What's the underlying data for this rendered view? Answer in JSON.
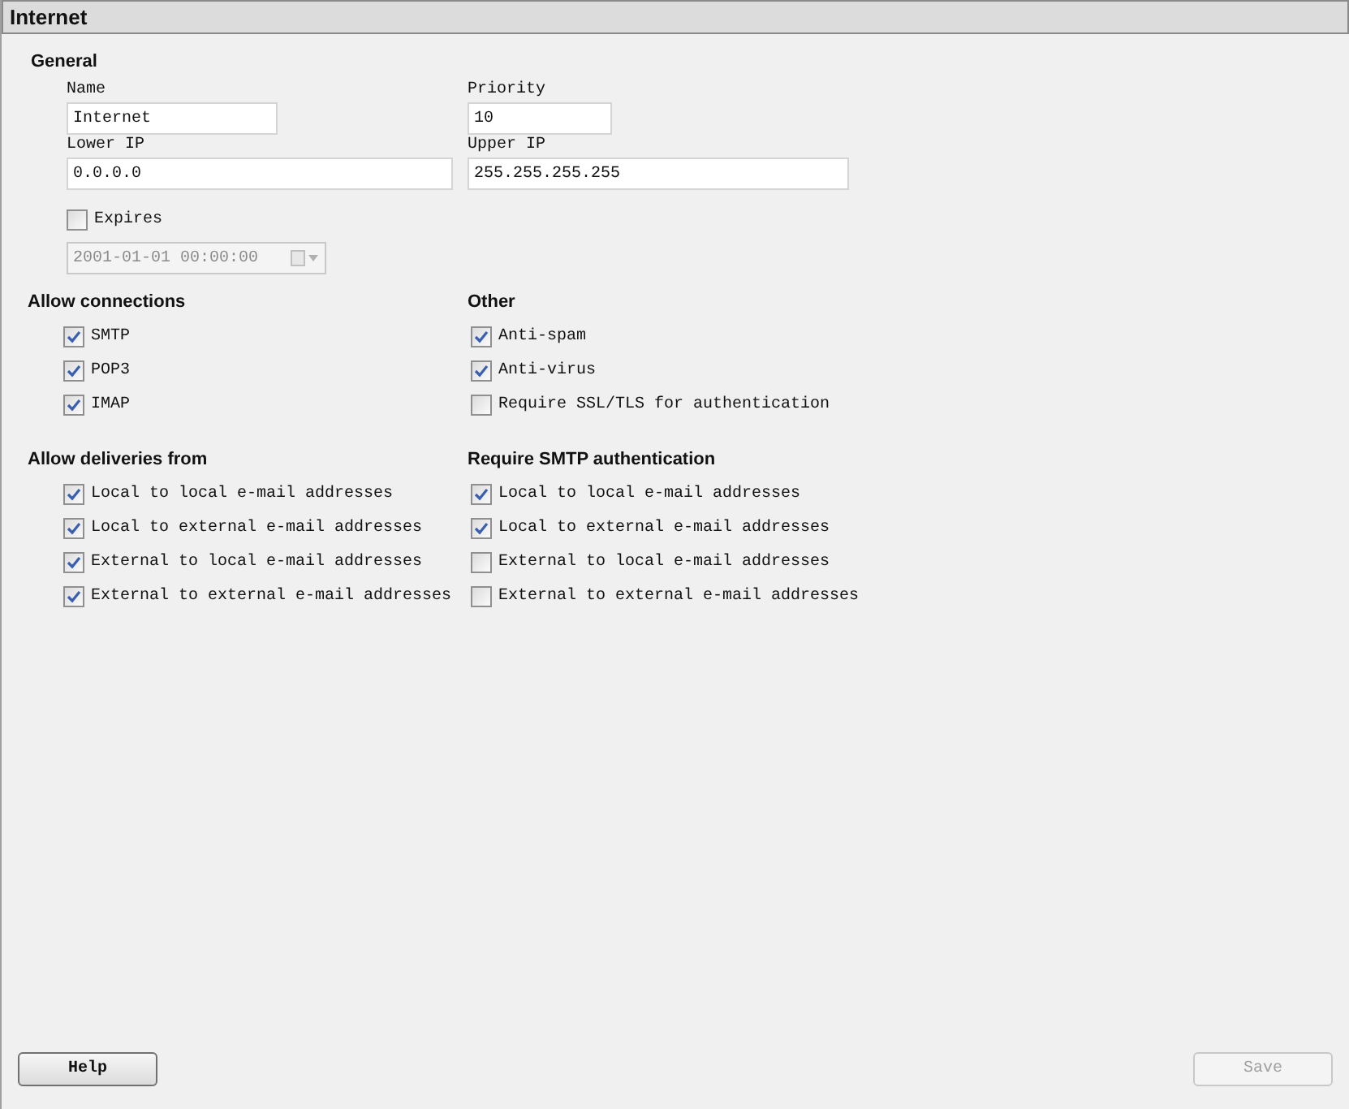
{
  "panel": {
    "title": "Internet"
  },
  "general": {
    "heading": "General",
    "fields": [
      {
        "label": "Name",
        "value": "Internet"
      },
      {
        "label": "Priority",
        "value": "10"
      },
      {
        "label": "Lower IP",
        "value": "0.0.0.0"
      },
      {
        "label": "Upper IP",
        "value": "255.255.255.255"
      }
    ],
    "expires": {
      "label": "Expires",
      "checked": false
    },
    "date": {
      "value": "2001-01-01 00:00:00",
      "disabled": true
    }
  },
  "sections": [
    {
      "heading": "Allow connections",
      "items": [
        {
          "label": "SMTP",
          "checked": true
        },
        {
          "label": "POP3",
          "checked": true
        },
        {
          "label": "IMAP",
          "checked": true
        }
      ]
    },
    {
      "heading": "Other",
      "items": [
        {
          "label": "Anti-spam",
          "checked": true
        },
        {
          "label": "Anti-virus",
          "checked": true
        },
        {
          "label": "Require SSL/TLS for authentication",
          "checked": false
        }
      ]
    },
    {
      "heading": "Allow deliveries from",
      "items": [
        {
          "label": "Local to local e-mail addresses",
          "checked": true
        },
        {
          "label": "Local to external e-mail addresses",
          "checked": true
        },
        {
          "label": "External to local e-mail addresses",
          "checked": true
        },
        {
          "label": "External to external e-mail addresses",
          "checked": true
        }
      ]
    },
    {
      "heading": "Require SMTP authentication",
      "items": [
        {
          "label": "Local to local e-mail addresses",
          "checked": true
        },
        {
          "label": "Local to external e-mail addresses",
          "checked": true
        },
        {
          "label": "External to local e-mail addresses",
          "checked": false
        },
        {
          "label": "External to external e-mail addresses",
          "checked": false
        }
      ]
    }
  ],
  "buttons": [
    {
      "label": "Help",
      "disabled": false
    },
    {
      "label": "Save",
      "disabled": true
    }
  ]
}
